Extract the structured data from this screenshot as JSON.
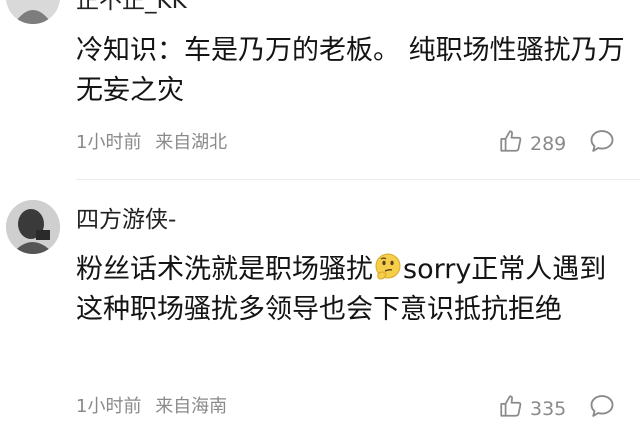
{
  "comments": [
    {
      "username": "正不正_KK",
      "text": "冷知识：车是乃万的老板。 纯职场性骚扰乃万无妄之灾",
      "time": "1小时前",
      "location": "来自湖北",
      "likes": "289"
    },
    {
      "username": "四方游侠-",
      "text_before_emoji": "粉丝话术洗就是职场骚扰",
      "emoji": "thinking-face",
      "text_after_emoji": "sorry正常人遇到这种职场骚扰多领导也会下意识抵抗拒绝",
      "time": "1小时前",
      "location": "来自海南",
      "likes": "335"
    }
  ],
  "icons": {
    "like": "thumbs-up-icon",
    "reply": "speech-bubble-icon"
  },
  "colors": {
    "meta_text": "#8a8a8a",
    "body_text": "#141414",
    "divider": "#ececec"
  }
}
